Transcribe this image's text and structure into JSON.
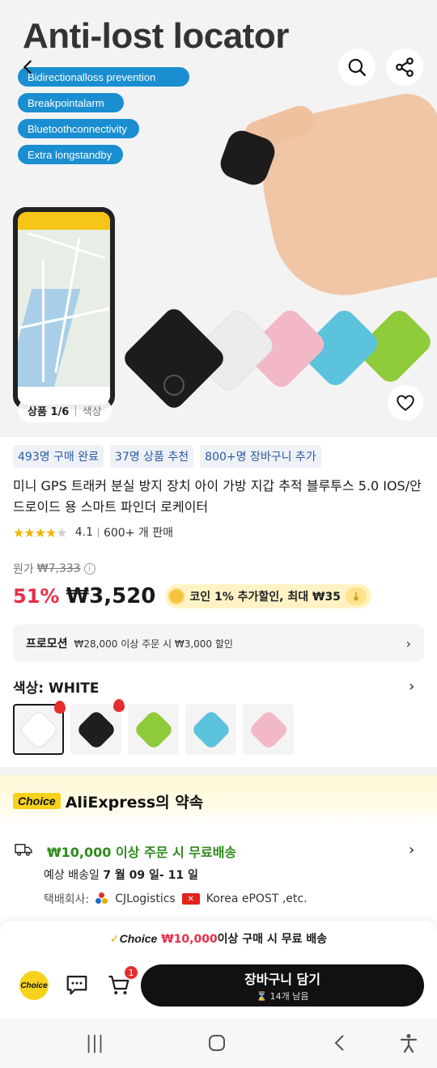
{
  "hero": {
    "headline": "Anti-lost locator",
    "features": [
      "Bidirectionalloss prevention",
      "Breakpointalarm",
      "Bluetoothconnectivity",
      "Extra longstandby"
    ],
    "image_counter": {
      "label": "상품 1/6",
      "tab": "색상"
    },
    "colors": {
      "pill": "#1a8ed0"
    }
  },
  "badges": [
    "493명 구매 완료",
    "37명 상품 추천",
    "800+명 장바구니 추가"
  ],
  "product": {
    "title": "미니 GPS 트래커 분실 방지 장치 아이 가방 지갑 추적 블루투스 5.0 IOS/안드로이드 용 스마트 파인더 로케이터",
    "rating": 4.1,
    "rating_text": "4.1",
    "sold_text": "600+ 개 판매"
  },
  "price": {
    "original_label": "원가",
    "original_value": "₩7,333",
    "discount": "51%",
    "current": "₩3,520",
    "coin_text": "코인 1% 추가할인, 최대 ₩35",
    "accent": "#e62e49"
  },
  "promotion": {
    "label": "프로모션",
    "text": "₩28,000 이상 주문 시 ₩3,000 할인"
  },
  "color_option": {
    "label": "색상: WHITE",
    "swatches": [
      {
        "name": "white",
        "color": "#ffffff",
        "hot": true,
        "selected": true
      },
      {
        "name": "black",
        "color": "#1e1e1e",
        "hot": true,
        "selected": false
      },
      {
        "name": "green",
        "color": "#8fcb3a",
        "hot": false,
        "selected": false
      },
      {
        "name": "blue",
        "color": "#5cc3dc",
        "hot": false,
        "selected": false
      },
      {
        "name": "pink",
        "color": "#f2b8c6",
        "hot": false,
        "selected": false
      }
    ]
  },
  "choice": {
    "logo": "Choice",
    "title": "AliExpress의 약속"
  },
  "shipping": {
    "free_text": "₩10,000 이상 주문 시 무료배송",
    "date_prefix": "예상 배송일 ",
    "date_value": "7 월 09 일- 11 일",
    "carrier_label": "택배회사:",
    "carrier_1": "CJLogistics",
    "carrier_2": "Korea ePOST ,etc."
  },
  "bottom": {
    "promo_choice": "Choice",
    "promo_amount": "₩10,000",
    "promo_rest": "이상 구매 시 무료 배송",
    "choice_badge": "Choice",
    "cart_count": "1",
    "cart_button": "장바구니 담기",
    "stock_text": "14개 남음"
  }
}
